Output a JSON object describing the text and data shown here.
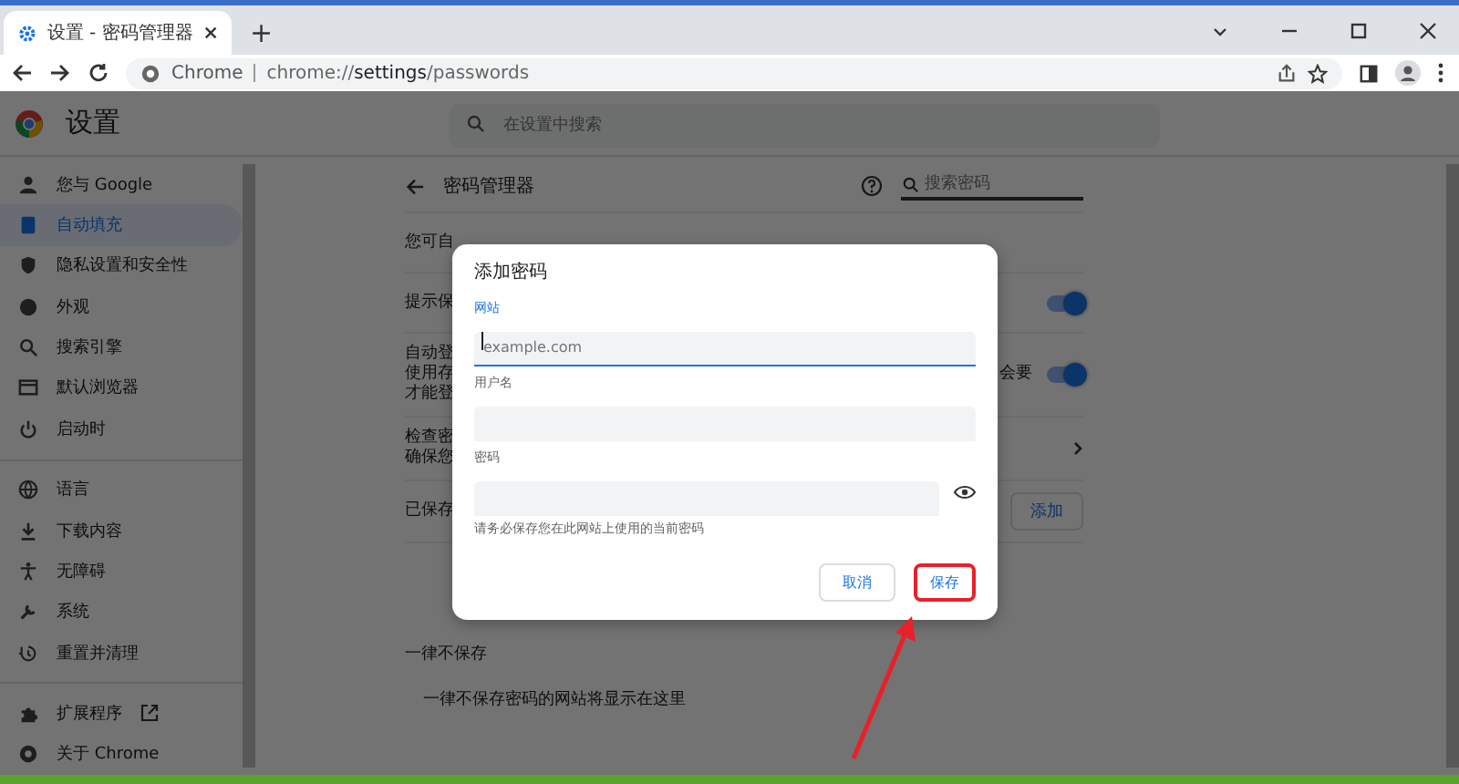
{
  "browser": {
    "tab": {
      "title": "设置 - 密码管理器"
    },
    "new_tab": "+",
    "address": {
      "site_label": "Chrome",
      "url": "chrome://**settings**/passwords"
    }
  },
  "settings_header": {
    "title": "设置",
    "search_placeholder": "在设置中搜索"
  },
  "sidebar": {
    "groups": [
      [
        {
          "label": "您与 Google",
          "selected": false
        },
        {
          "label": "自动填充",
          "selected": true
        },
        {
          "label": "隐私设置和安全性",
          "selected": false
        },
        {
          "label": "外观",
          "selected": false
        },
        {
          "label": "搜索引擎",
          "selected": false
        },
        {
          "label": "默认浏览器",
          "selected": false
        },
        {
          "label": "启动时",
          "selected": false
        }
      ],
      [
        {
          "label": "语言",
          "selected": false
        },
        {
          "label": "下载内容",
          "selected": false
        },
        {
          "label": "无障碍",
          "selected": false
        },
        {
          "label": "系统",
          "selected": false
        },
        {
          "label": "重置并清理",
          "selected": false
        }
      ],
      [
        {
          "label": "扩展程序",
          "selected": false,
          "external": true
        },
        {
          "label": "关于 Chrome",
          "selected": false
        }
      ]
    ]
  },
  "page": {
    "title": "密码管理器",
    "search_placeholder": "搜索密码",
    "rows": [
      {
        "kind": "text",
        "lines": [
          "您可自"
        ]
      },
      {
        "kind": "toggle",
        "lines": [
          "提示保"
        ],
        "on": true
      },
      {
        "kind": "toggle",
        "lines": [
          "自动登",
          "使用存",
          "才能登"
        ],
        "trailing": "会要",
        "on": true
      },
      {
        "kind": "link",
        "lines": [
          "检查密",
          "确保您"
        ]
      }
    ],
    "saved": {
      "label": "已保存",
      "add_button": "添加"
    },
    "never_saved": {
      "title": "一律不保存",
      "empty_text": "一律不保存密码的网站将显示在这里"
    }
  },
  "dialog": {
    "title": "添加密码",
    "fields": [
      {
        "label": "网站",
        "placeholder": "example.com",
        "focused": true,
        "kind": "text"
      },
      {
        "label": "用户名",
        "focused": false,
        "kind": "text"
      },
      {
        "label": "密码",
        "focused": false,
        "kind": "password"
      }
    ],
    "hint": "请务必保存您在此网站上使用的当前密码",
    "buttons": [
      {
        "label": "取消",
        "highlighted": false
      },
      {
        "label": "保存",
        "highlighted": true
      }
    ]
  }
}
